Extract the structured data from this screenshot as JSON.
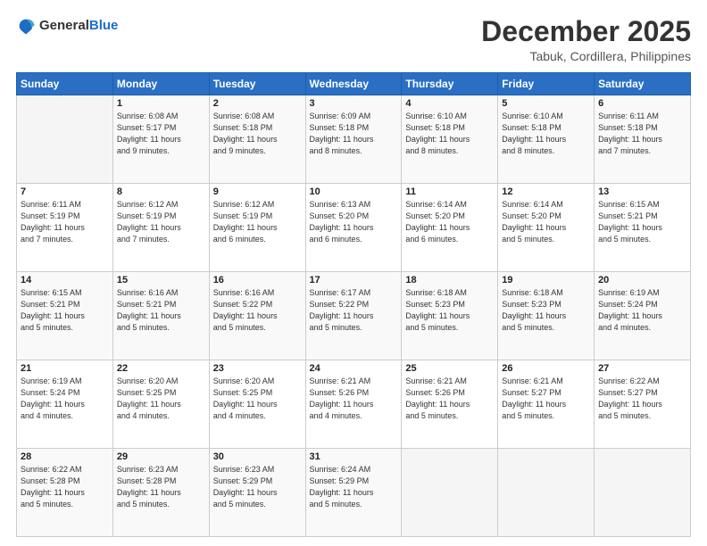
{
  "header": {
    "logo_general": "General",
    "logo_blue": "Blue",
    "month": "December 2025",
    "location": "Tabuk, Cordillera, Philippines"
  },
  "days_of_week": [
    "Sunday",
    "Monday",
    "Tuesday",
    "Wednesday",
    "Thursday",
    "Friday",
    "Saturday"
  ],
  "weeks": [
    [
      {
        "day": "",
        "info": ""
      },
      {
        "day": "1",
        "info": "Sunrise: 6:08 AM\nSunset: 5:17 PM\nDaylight: 11 hours\nand 9 minutes."
      },
      {
        "day": "2",
        "info": "Sunrise: 6:08 AM\nSunset: 5:18 PM\nDaylight: 11 hours\nand 9 minutes."
      },
      {
        "day": "3",
        "info": "Sunrise: 6:09 AM\nSunset: 5:18 PM\nDaylight: 11 hours\nand 8 minutes."
      },
      {
        "day": "4",
        "info": "Sunrise: 6:10 AM\nSunset: 5:18 PM\nDaylight: 11 hours\nand 8 minutes."
      },
      {
        "day": "5",
        "info": "Sunrise: 6:10 AM\nSunset: 5:18 PM\nDaylight: 11 hours\nand 8 minutes."
      },
      {
        "day": "6",
        "info": "Sunrise: 6:11 AM\nSunset: 5:18 PM\nDaylight: 11 hours\nand 7 minutes."
      }
    ],
    [
      {
        "day": "7",
        "info": "Sunrise: 6:11 AM\nSunset: 5:19 PM\nDaylight: 11 hours\nand 7 minutes."
      },
      {
        "day": "8",
        "info": "Sunrise: 6:12 AM\nSunset: 5:19 PM\nDaylight: 11 hours\nand 7 minutes."
      },
      {
        "day": "9",
        "info": "Sunrise: 6:12 AM\nSunset: 5:19 PM\nDaylight: 11 hours\nand 6 minutes."
      },
      {
        "day": "10",
        "info": "Sunrise: 6:13 AM\nSunset: 5:20 PM\nDaylight: 11 hours\nand 6 minutes."
      },
      {
        "day": "11",
        "info": "Sunrise: 6:14 AM\nSunset: 5:20 PM\nDaylight: 11 hours\nand 6 minutes."
      },
      {
        "day": "12",
        "info": "Sunrise: 6:14 AM\nSunset: 5:20 PM\nDaylight: 11 hours\nand 5 minutes."
      },
      {
        "day": "13",
        "info": "Sunrise: 6:15 AM\nSunset: 5:21 PM\nDaylight: 11 hours\nand 5 minutes."
      }
    ],
    [
      {
        "day": "14",
        "info": "Sunrise: 6:15 AM\nSunset: 5:21 PM\nDaylight: 11 hours\nand 5 minutes."
      },
      {
        "day": "15",
        "info": "Sunrise: 6:16 AM\nSunset: 5:21 PM\nDaylight: 11 hours\nand 5 minutes."
      },
      {
        "day": "16",
        "info": "Sunrise: 6:16 AM\nSunset: 5:22 PM\nDaylight: 11 hours\nand 5 minutes."
      },
      {
        "day": "17",
        "info": "Sunrise: 6:17 AM\nSunset: 5:22 PM\nDaylight: 11 hours\nand 5 minutes."
      },
      {
        "day": "18",
        "info": "Sunrise: 6:18 AM\nSunset: 5:23 PM\nDaylight: 11 hours\nand 5 minutes."
      },
      {
        "day": "19",
        "info": "Sunrise: 6:18 AM\nSunset: 5:23 PM\nDaylight: 11 hours\nand 5 minutes."
      },
      {
        "day": "20",
        "info": "Sunrise: 6:19 AM\nSunset: 5:24 PM\nDaylight: 11 hours\nand 4 minutes."
      }
    ],
    [
      {
        "day": "21",
        "info": "Sunrise: 6:19 AM\nSunset: 5:24 PM\nDaylight: 11 hours\nand 4 minutes."
      },
      {
        "day": "22",
        "info": "Sunrise: 6:20 AM\nSunset: 5:25 PM\nDaylight: 11 hours\nand 4 minutes."
      },
      {
        "day": "23",
        "info": "Sunrise: 6:20 AM\nSunset: 5:25 PM\nDaylight: 11 hours\nand 4 minutes."
      },
      {
        "day": "24",
        "info": "Sunrise: 6:21 AM\nSunset: 5:26 PM\nDaylight: 11 hours\nand 4 minutes."
      },
      {
        "day": "25",
        "info": "Sunrise: 6:21 AM\nSunset: 5:26 PM\nDaylight: 11 hours\nand 5 minutes."
      },
      {
        "day": "26",
        "info": "Sunrise: 6:21 AM\nSunset: 5:27 PM\nDaylight: 11 hours\nand 5 minutes."
      },
      {
        "day": "27",
        "info": "Sunrise: 6:22 AM\nSunset: 5:27 PM\nDaylight: 11 hours\nand 5 minutes."
      }
    ],
    [
      {
        "day": "28",
        "info": "Sunrise: 6:22 AM\nSunset: 5:28 PM\nDaylight: 11 hours\nand 5 minutes."
      },
      {
        "day": "29",
        "info": "Sunrise: 6:23 AM\nSunset: 5:28 PM\nDaylight: 11 hours\nand 5 minutes."
      },
      {
        "day": "30",
        "info": "Sunrise: 6:23 AM\nSunset: 5:29 PM\nDaylight: 11 hours\nand 5 minutes."
      },
      {
        "day": "31",
        "info": "Sunrise: 6:24 AM\nSunset: 5:29 PM\nDaylight: 11 hours\nand 5 minutes."
      },
      {
        "day": "",
        "info": ""
      },
      {
        "day": "",
        "info": ""
      },
      {
        "day": "",
        "info": ""
      }
    ]
  ]
}
